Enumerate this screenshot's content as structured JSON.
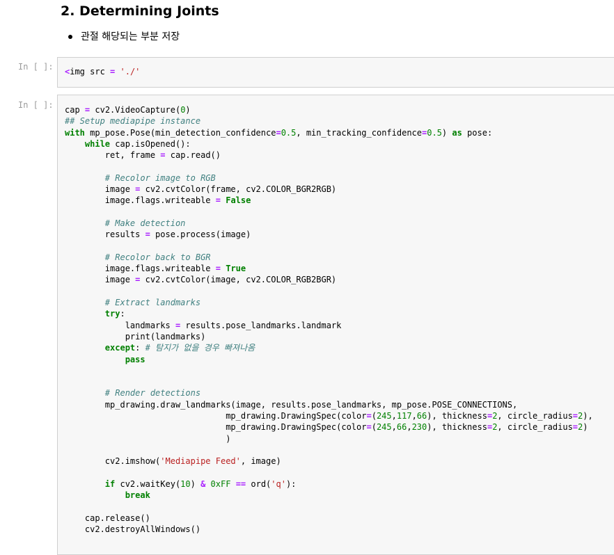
{
  "markdown": {
    "heading": "2. Determining Joints",
    "bullets": [
      "관절 해당되는 부분 저장"
    ]
  },
  "cells": [
    {
      "prompt": "In [ ]:",
      "lines": [
        [
          [
            "op",
            "<"
          ],
          [
            "nm",
            "img src "
          ],
          [
            "op",
            "="
          ],
          [
            "nm",
            " "
          ],
          [
            "str",
            "'./'"
          ]
        ]
      ]
    },
    {
      "prompt": "In [ ]:",
      "lines": [
        [
          [
            "nm",
            "cap "
          ],
          [
            "op",
            "="
          ],
          [
            "nm",
            " cv2.VideoCapture("
          ],
          [
            "num",
            "0"
          ],
          [
            "nm",
            ")"
          ]
        ],
        [
          [
            "com",
            "## Setup mediapipe instance"
          ]
        ],
        [
          [
            "kw",
            "with"
          ],
          [
            "nm",
            " mp_pose.Pose(min_detection_confidence"
          ],
          [
            "op",
            "="
          ],
          [
            "num",
            "0.5"
          ],
          [
            "nm",
            ", min_tracking_confidence"
          ],
          [
            "op",
            "="
          ],
          [
            "num",
            "0.5"
          ],
          [
            "nm",
            ") "
          ],
          [
            "kw",
            "as"
          ],
          [
            "nm",
            " pose:"
          ]
        ],
        [
          [
            "nm",
            "    "
          ],
          [
            "kw",
            "while"
          ],
          [
            "nm",
            " cap.isOpened():"
          ]
        ],
        [
          [
            "nm",
            "        ret, frame "
          ],
          [
            "op",
            "="
          ],
          [
            "nm",
            " cap.read()"
          ]
        ],
        [],
        [
          [
            "nm",
            "        "
          ],
          [
            "com",
            "# Recolor image to RGB"
          ]
        ],
        [
          [
            "nm",
            "        image "
          ],
          [
            "op",
            "="
          ],
          [
            "nm",
            " cv2.cvtColor(frame, cv2.COLOR_BGR2RGB)"
          ]
        ],
        [
          [
            "nm",
            "        image.flags.writeable "
          ],
          [
            "op",
            "="
          ],
          [
            "nm",
            " "
          ],
          [
            "kw",
            "False"
          ]
        ],
        [],
        [
          [
            "nm",
            "        "
          ],
          [
            "com",
            "# Make detection"
          ]
        ],
        [
          [
            "nm",
            "        results "
          ],
          [
            "op",
            "="
          ],
          [
            "nm",
            " pose.process(image)"
          ]
        ],
        [],
        [
          [
            "nm",
            "        "
          ],
          [
            "com",
            "# Recolor back to BGR"
          ]
        ],
        [
          [
            "nm",
            "        image.flags.writeable "
          ],
          [
            "op",
            "="
          ],
          [
            "nm",
            " "
          ],
          [
            "kw",
            "True"
          ]
        ],
        [
          [
            "nm",
            "        image "
          ],
          [
            "op",
            "="
          ],
          [
            "nm",
            " cv2.cvtColor(image, cv2.COLOR_RGB2BGR)"
          ]
        ],
        [],
        [
          [
            "nm",
            "        "
          ],
          [
            "com",
            "# Extract landmarks"
          ]
        ],
        [
          [
            "nm",
            "        "
          ],
          [
            "kw",
            "try"
          ],
          [
            "nm",
            ":"
          ]
        ],
        [
          [
            "nm",
            "            landmarks "
          ],
          [
            "op",
            "="
          ],
          [
            "nm",
            " results.pose_landmarks.landmark"
          ]
        ],
        [
          [
            "nm",
            "            print(landmarks)"
          ]
        ],
        [
          [
            "nm",
            "        "
          ],
          [
            "kw",
            "except"
          ],
          [
            "nm",
            ": "
          ],
          [
            "com",
            "# 탐지가 없을 경우 빠져나옴"
          ]
        ],
        [
          [
            "nm",
            "            "
          ],
          [
            "kw",
            "pass"
          ]
        ],
        [],
        [],
        [
          [
            "nm",
            "        "
          ],
          [
            "com",
            "# Render detections"
          ]
        ],
        [
          [
            "nm",
            "        mp_drawing.draw_landmarks(image, results.pose_landmarks, mp_pose.POSE_CONNECTIONS,"
          ]
        ],
        [
          [
            "nm",
            "                                mp_drawing.DrawingSpec(color"
          ],
          [
            "op",
            "="
          ],
          [
            "nm",
            "("
          ],
          [
            "num",
            "245"
          ],
          [
            "nm",
            ","
          ],
          [
            "num",
            "117"
          ],
          [
            "nm",
            ","
          ],
          [
            "num",
            "66"
          ],
          [
            "nm",
            "), thickness"
          ],
          [
            "op",
            "="
          ],
          [
            "num",
            "2"
          ],
          [
            "nm",
            ", circle_radius"
          ],
          [
            "op",
            "="
          ],
          [
            "num",
            "2"
          ],
          [
            "nm",
            "),"
          ]
        ],
        [
          [
            "nm",
            "                                mp_drawing.DrawingSpec(color"
          ],
          [
            "op",
            "="
          ],
          [
            "nm",
            "("
          ],
          [
            "num",
            "245"
          ],
          [
            "nm",
            ","
          ],
          [
            "num",
            "66"
          ],
          [
            "nm",
            ","
          ],
          [
            "num",
            "230"
          ],
          [
            "nm",
            "), thickness"
          ],
          [
            "op",
            "="
          ],
          [
            "num",
            "2"
          ],
          [
            "nm",
            ", circle_radius"
          ],
          [
            "op",
            "="
          ],
          [
            "num",
            "2"
          ],
          [
            "nm",
            ")"
          ]
        ],
        [
          [
            "nm",
            "                                )"
          ]
        ],
        [],
        [
          [
            "nm",
            "        cv2.imshow("
          ],
          [
            "str",
            "'Mediapipe Feed'"
          ],
          [
            "nm",
            ", image)"
          ]
        ],
        [],
        [
          [
            "nm",
            "        "
          ],
          [
            "kw",
            "if"
          ],
          [
            "nm",
            " cv2.waitKey("
          ],
          [
            "num",
            "10"
          ],
          [
            "nm",
            ") "
          ],
          [
            "op",
            "&"
          ],
          [
            "nm",
            " "
          ],
          [
            "num",
            "0xFF"
          ],
          [
            "nm",
            " "
          ],
          [
            "op",
            "=="
          ],
          [
            "nm",
            " ord("
          ],
          [
            "str",
            "'q'"
          ],
          [
            "nm",
            "):"
          ]
        ],
        [
          [
            "nm",
            "            "
          ],
          [
            "kw",
            "break"
          ]
        ],
        [],
        [
          [
            "nm",
            "    cap.release()"
          ]
        ],
        [
          [
            "nm",
            "    cv2.destroyAllWindows()"
          ]
        ]
      ]
    }
  ]
}
